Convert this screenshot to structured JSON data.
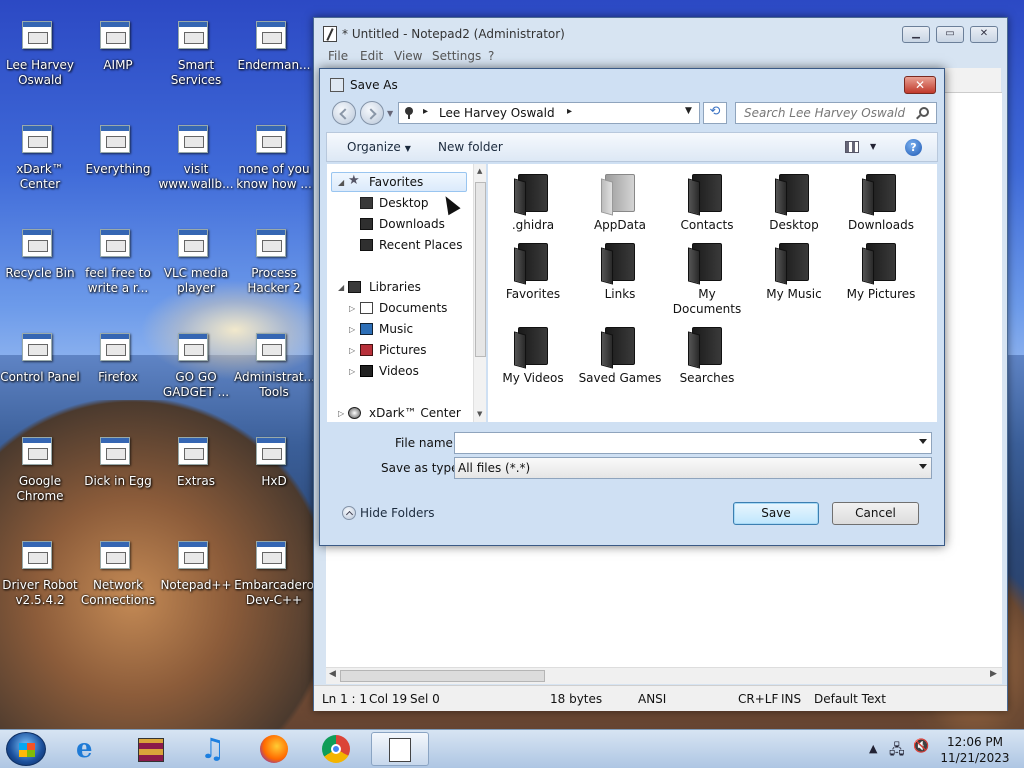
{
  "desktop": {
    "icons": [
      {
        "label": "Lee Harvey Oswald",
        "icon": "user-folder-icon"
      },
      {
        "label": "AIMP",
        "icon": "aimp-icon"
      },
      {
        "label": "Smart Services",
        "icon": "gear-icon"
      },
      {
        "label": "Enderman...",
        "icon": "shortcut-icon"
      },
      {
        "label": "xDark™ Center",
        "icon": "xdark-center-icon"
      },
      {
        "label": "Everything",
        "icon": "everything-search-icon"
      },
      {
        "label": "visit www.wallb...",
        "icon": "document-icon"
      },
      {
        "label": "none of you know how ...",
        "icon": "shortcut-icon"
      },
      {
        "label": "Recycle Bin",
        "icon": "recycle-bin-icon"
      },
      {
        "label": "feel free to write a r...",
        "icon": "document-icon"
      },
      {
        "label": "VLC media player",
        "icon": "vlc-icon"
      },
      {
        "label": "Process Hacker 2",
        "icon": "process-hacker-icon"
      },
      {
        "label": "Control Panel",
        "icon": "control-panel-icon"
      },
      {
        "label": "Firefox",
        "icon": "firefox-icon"
      },
      {
        "label": "GO GO GADGET ...",
        "icon": "folder-icon"
      },
      {
        "label": "Administrat... Tools",
        "icon": "admin-tools-icon"
      },
      {
        "label": "Google Chrome",
        "icon": "chrome-icon"
      },
      {
        "label": "Dick in Egg",
        "icon": "game-icon"
      },
      {
        "label": "Extras",
        "icon": "folder-icon"
      },
      {
        "label": "HxD",
        "icon": "hxd-icon"
      },
      {
        "label": "Driver Robot v2.5.4.2",
        "icon": "driver-robot-icon"
      },
      {
        "label": "Network Connections",
        "icon": "network-icon"
      },
      {
        "label": "Notepad++",
        "icon": "notepad-plus-icon"
      },
      {
        "label": "Embarcadero Dev-C++",
        "icon": "devcpp-icon"
      }
    ]
  },
  "notepad": {
    "title": "* Untitled - Notepad2 (Administrator)",
    "menu": [
      "File",
      "Edit",
      "View",
      "Settings",
      "?"
    ],
    "status": {
      "position": "Ln 1 : 1",
      "col": "Col 19",
      "sel": "Sel 0",
      "size": "18 bytes",
      "encoding": "ANSI",
      "eol": "CR+LF",
      "mode": "INS",
      "scheme": "Default Text"
    }
  },
  "dialog": {
    "title": "Save As",
    "close": "✕",
    "breadcrumb": "Lee Harvey Oswald",
    "search_placeholder": "Search Lee Harvey Oswald",
    "toolbar": {
      "organize": "Organize",
      "new_folder": "New folder",
      "help": "?"
    },
    "nav": {
      "favorites": "Favorites",
      "favorites_items": [
        "Desktop",
        "Downloads",
        "Recent Places"
      ],
      "libraries": "Libraries",
      "libraries_items": [
        "Documents",
        "Music",
        "Pictures",
        "Videos"
      ],
      "xdark": "xDark™ Center"
    },
    "files": [
      {
        "name": ".ghidra",
        "style": "dark"
      },
      {
        "name": "AppData",
        "style": "grey"
      },
      {
        "name": "Contacts",
        "style": "dark"
      },
      {
        "name": "Desktop",
        "style": "dark"
      },
      {
        "name": "Downloads",
        "style": "dark"
      },
      {
        "name": "Favorites",
        "style": "dark"
      },
      {
        "name": "Links",
        "style": "dark"
      },
      {
        "name": "My Documents",
        "style": "dark"
      },
      {
        "name": "My Music",
        "style": "dark"
      },
      {
        "name": "My Pictures",
        "style": "dark"
      },
      {
        "name": "My Videos",
        "style": "dark"
      },
      {
        "name": "Saved Games",
        "style": "dark"
      },
      {
        "name": "Searches",
        "style": "dark"
      }
    ],
    "file_name_label": "File name:",
    "file_name_value": "",
    "save_type_label": "Save as type:",
    "save_type_value": "All files (*.*)",
    "hide_folders": "Hide Folders",
    "save": "Save",
    "cancel": "Cancel"
  },
  "taskbar": {
    "time": "12:06 PM",
    "date": "11/21/2023",
    "pinned": [
      "internet-explorer-icon",
      "winrar-icon",
      "music-icon",
      "firefox-icon",
      "chrome-icon",
      "notepad2-icon"
    ]
  }
}
